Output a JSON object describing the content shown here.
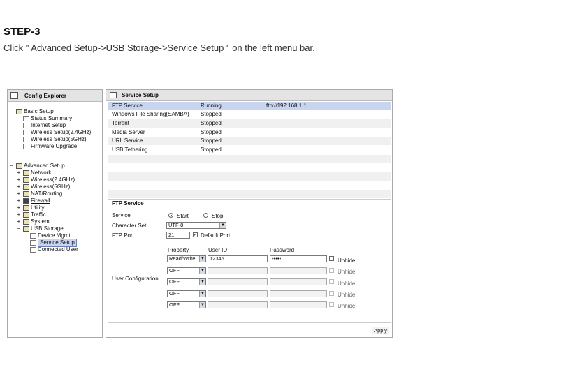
{
  "doc": {
    "step_title": "STEP-3",
    "instr_prefix": "Click \" ",
    "instr_path": "Advanced Setup->USB Storage->Service Setup",
    "instr_suffix": " \" on the left menu bar."
  },
  "left_panel": {
    "title": "Config Explorer",
    "basic": {
      "label": "Basic Setup",
      "items": [
        "Status Summary",
        "Internet Setup",
        "Wireless Setup(2.4GHz)",
        "Wireless Setup(5GHz)",
        "Firmware Upgrade"
      ]
    },
    "advanced": {
      "expander": "−",
      "label": "Advanced Setup",
      "items": [
        "Network",
        "Wireless(2.4GHz)",
        "Wireless(5GHz)",
        "NAT/Routing",
        "Firewall",
        "Utility",
        "Traffic",
        "System",
        "USB Storage"
      ],
      "expanders": [
        "+",
        "+",
        "+",
        "+",
        "+",
        "+",
        "+",
        "+",
        "−"
      ],
      "usb_children": [
        "Device Mgmt",
        "Service Setup",
        "Connected User"
      ]
    }
  },
  "right_panel": {
    "title": "Service Setup",
    "services": [
      {
        "name": "FTP Service",
        "status": "Running",
        "info": "ftp://192.168.1.1"
      },
      {
        "name": "Windows File Sharing(SAMBA)",
        "status": "Stopped",
        "info": ""
      },
      {
        "name": "Torrent",
        "status": "Stopped",
        "info": ""
      },
      {
        "name": "Media Server",
        "status": "Stopped",
        "info": ""
      },
      {
        "name": "URL Service",
        "status": "Stopped",
        "info": ""
      },
      {
        "name": "USB Tethering",
        "status": "Stopped",
        "info": ""
      }
    ],
    "ftp": {
      "section_title": "FTP Service",
      "service_label": "Service",
      "start_label": "Start",
      "stop_label": "Stop",
      "charset_label": "Character Set",
      "charset_value": "UTF-8",
      "port_label": "FTP Port",
      "port_value": "21",
      "default_port_label": "Default Port",
      "user_config_label": "User Configuration",
      "col_property": "Property",
      "col_userid": "User ID",
      "col_password": "Password",
      "users": [
        {
          "property": "Read/Write",
          "userid": "12345",
          "password": "•••••",
          "unhide": "Unhide"
        },
        {
          "property": "OFF",
          "userid": "",
          "password": "",
          "unhide": "Unhide"
        },
        {
          "property": "OFF",
          "userid": "",
          "password": "",
          "unhide": "Unhide"
        },
        {
          "property": "OFF",
          "userid": "",
          "password": "",
          "unhide": "Unhide"
        },
        {
          "property": "OFF",
          "userid": "",
          "password": "",
          "unhide": "Unhide"
        }
      ],
      "apply_label": "Apply"
    }
  }
}
